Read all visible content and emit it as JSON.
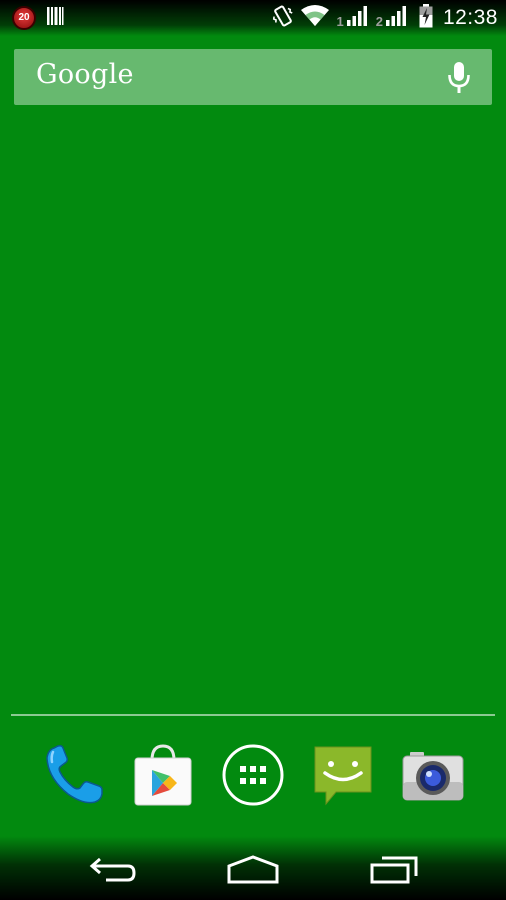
{
  "status_bar": {
    "notification_count": "20",
    "sim1_label": "1",
    "sim2_label": "2",
    "time": "12:38"
  },
  "search": {
    "logo_text": "Google"
  },
  "dock": {
    "apps": [
      "phone-icon",
      "play-store-icon",
      "app-drawer-icon",
      "messaging-icon",
      "camera-icon"
    ]
  },
  "nav": {
    "buttons": [
      "back-icon",
      "home-icon",
      "recent-apps-icon"
    ]
  },
  "colors": {
    "wallpaper": "#028a0f",
    "phone_blue": "#1a9ee8",
    "messaging_green": "#8bb82a"
  }
}
